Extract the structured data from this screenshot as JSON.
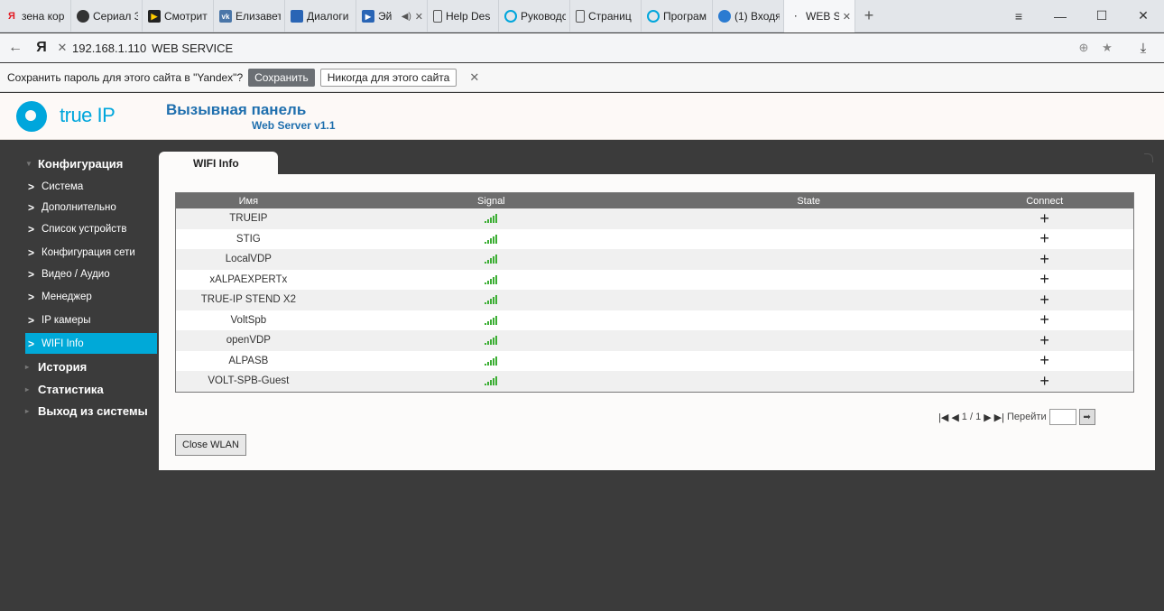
{
  "browser": {
    "tabs": [
      {
        "label": "зена кор",
        "icon": "yandex-icon"
      },
      {
        "label": "Сериал З",
        "icon": "mask-icon"
      },
      {
        "label": "Смотрит",
        "icon": "play-icon"
      },
      {
        "label": "Елизавет",
        "icon": "vk-icon"
      },
      {
        "label": "Диалоги",
        "icon": "chat-icon"
      },
      {
        "label": "Эй",
        "icon": "play-icon"
      },
      {
        "label": "Help Des",
        "icon": "page-icon"
      },
      {
        "label": "Руководс",
        "icon": "trueip-icon"
      },
      {
        "label": "Страниц",
        "icon": "page-icon"
      },
      {
        "label": "Програм",
        "icon": "trueip-icon"
      },
      {
        "label": "(1) Входя",
        "icon": "mail-icon"
      },
      {
        "label": "WEB S",
        "icon": "page-icon"
      }
    ],
    "address_host": "192.168.1.110",
    "address_title": "WEB SERVICE",
    "logo_letter": "Я",
    "password_prompt": "Сохранить пароль для этого сайта в \"Yandex\"?",
    "password_save": "Сохранить",
    "password_never": "Никогда для этого сайта"
  },
  "header": {
    "logo_text": "true IP",
    "title": "Вызывная панель",
    "subtitle": "Web Server v1.1"
  },
  "sidebar": {
    "config": "Конфигурация",
    "items": [
      "Система",
      "Дополнительно",
      "Список устройств",
      "Конфигурация сети",
      "Видео / Аудио",
      "Менеджер",
      "IP камеры",
      "WIFI Info"
    ],
    "history": "История",
    "stats": "Статистика",
    "logout": "Выход из системы"
  },
  "content": {
    "tab": "WIFI Info",
    "columns": [
      "Имя",
      "Signal",
      "State",
      "Connect"
    ],
    "rows": [
      {
        "name": "TRUEIP",
        "signal": 5,
        "state": "",
        "connect": "+"
      },
      {
        "name": "STIG",
        "signal": 5,
        "state": "",
        "connect": "+"
      },
      {
        "name": "LocalVDP",
        "signal": 5,
        "state": "",
        "connect": "+"
      },
      {
        "name": "xALPAEXPERTx",
        "signal": 5,
        "state": "",
        "connect": "+"
      },
      {
        "name": "TRUE-IP STEND X2",
        "signal": 5,
        "state": "",
        "connect": "+"
      },
      {
        "name": "VoltSpb",
        "signal": 5,
        "state": "",
        "connect": "+"
      },
      {
        "name": "openVDP",
        "signal": 5,
        "state": "",
        "connect": "+"
      },
      {
        "name": "ALPASB",
        "signal": 5,
        "state": "",
        "connect": "+"
      },
      {
        "name": "VOLT-SPB-Guest",
        "signal": 5,
        "state": "",
        "connect": "+"
      }
    ],
    "pager_text": "1 / 1",
    "pager_goto": "Перейти",
    "close_button": "Close WLAN"
  },
  "colors": {
    "accent": "#00a9d8",
    "signal": "#3cae34",
    "header_text": "#1f6fae"
  }
}
